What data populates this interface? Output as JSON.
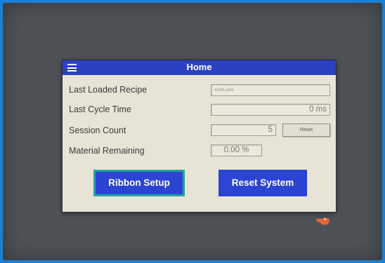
{
  "header": {
    "title": "Home",
    "menu_icon": "hamburger-menu-icon"
  },
  "rows": {
    "recipe": {
      "label": "Last Loaded Recipe",
      "value": "419A.xml"
    },
    "cycle": {
      "label": "Last Cycle Time",
      "value": "0 ms"
    },
    "session": {
      "label": "Session Count",
      "value": "5",
      "reset_label": "Reset"
    },
    "material": {
      "label": "Material Remaining",
      "value": "0.00 %"
    }
  },
  "buttons": {
    "ribbon_setup": "Ribbon Setup",
    "reset_system": "Reset System"
  },
  "colors": {
    "titlebar": "#2b41c2",
    "button": "#2c44d3",
    "focus_outline": "#1fa59a",
    "screen_bg": "#e7e4d6"
  },
  "icons": {
    "hand": "hand-pointer-icon"
  }
}
